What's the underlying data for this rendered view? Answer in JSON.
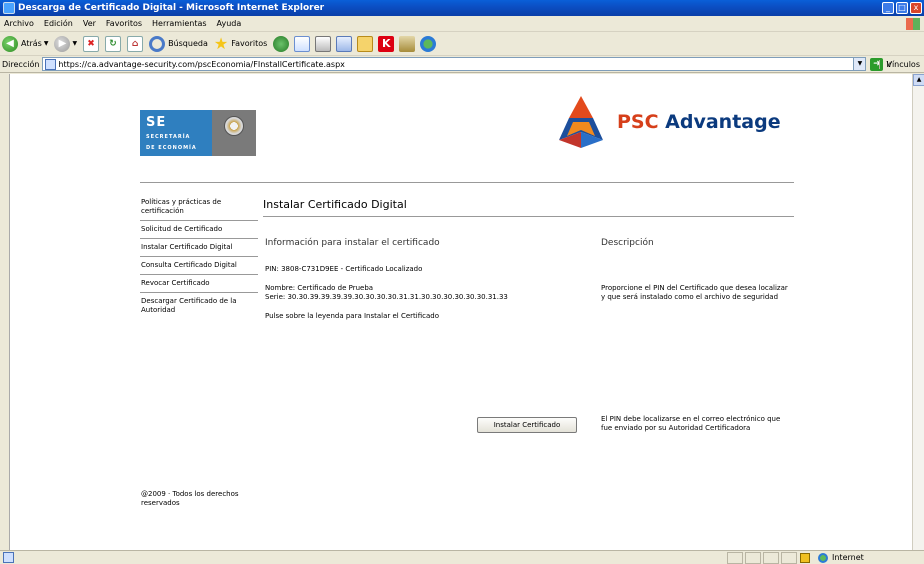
{
  "window": {
    "title": "Descarga de Certificado Digital - Microsoft Internet Explorer",
    "buttons": {
      "minimize": "_",
      "maximize": "□",
      "close": "x"
    }
  },
  "menu": [
    "Archivo",
    "Edición",
    "Ver",
    "Favoritos",
    "Herramientas",
    "Ayuda"
  ],
  "toolbar": {
    "back_label": "Atrás",
    "search_label": "Búsqueda",
    "favorites_label": "Favoritos"
  },
  "address": {
    "label": "Dirección",
    "url": "https://ca.advantage-security.com/pscEconomia/FInstallCertificate.aspx",
    "go_label": "Ir",
    "links_label": "Vínculos"
  },
  "logos": {
    "se_big": "SE",
    "se_line1": "SECRETARÍA",
    "se_line2": "DE ECONOMÍA",
    "psc_part1": "PSC ",
    "psc_part2": "Advantage"
  },
  "sidebar": {
    "items": [
      "Políticas y prácticas de certificación",
      "Solicitud de Certificado",
      "Instalar Certificado Digital",
      "Consulta Certificado Digital",
      "Revocar Certificado",
      "Descargar Certificado de la Autoridad"
    ],
    "footer": "@2009 · Todos los derechos reservados"
  },
  "main": {
    "title": "Instalar Certificado Digital",
    "info_heading": "Información para instalar el certificado",
    "desc_heading": "Descripción",
    "pin_line": "PIN: 3808-C731D9EE - Certificado Localizado",
    "name_line": "Nombre: Certificado de Prueba",
    "serial_line": "Serie: 30.30.39.39.39.39.30.30.30.30.31.31.30.30.30.30.30.30.31.33",
    "instruction": "Pulse sobre la leyenda para Instalar el Certificado",
    "install_button": "Instalar Certificado",
    "desc1": "Proporcione el PIN del Certificado que desea localizar y que será instalado como el archivo de seguridad",
    "desc2": "El PIN debe localizarse en el correo electrónico que fue enviado por su Autoridad Certificadora"
  },
  "status": {
    "zone": "Internet"
  }
}
